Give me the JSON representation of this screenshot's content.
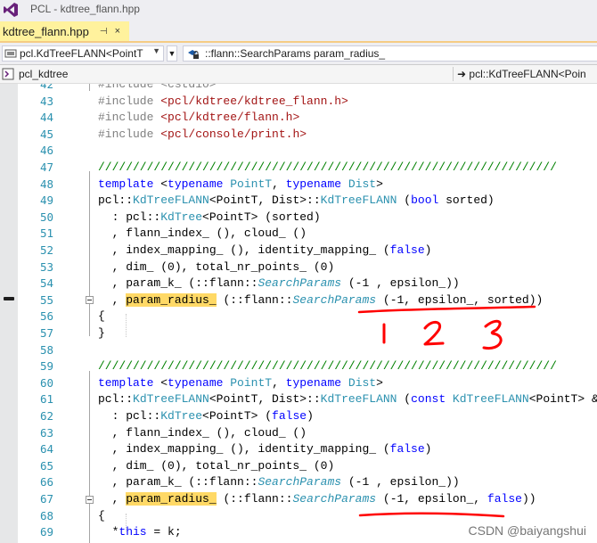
{
  "window": {
    "title": "PCL - kdtree_flann.hpp"
  },
  "tab": {
    "name": "kdtree_flann.hpp",
    "pin_glyph": "⊣",
    "close_glyph": "×"
  },
  "nav": {
    "scope": "pcl.KdTreeFLANN<PointT",
    "member": "::flann::SearchParams param_radius_",
    "project": "pcl_kdtree",
    "location": "➜ pcl::KdTreeFLANN<Poin"
  },
  "editor": {
    "lines": [
      {
        "n": "42",
        "tokens": [
          {
            "t": "#include <cstdio>",
            "c": "t-pp"
          }
        ]
      },
      {
        "n": "43",
        "tokens": [
          {
            "t": "#include ",
            "c": "t-pp"
          },
          {
            "t": "<pcl/kdtree/kdtree_flann.h>",
            "c": "t-str"
          }
        ]
      },
      {
        "n": "44",
        "tokens": [
          {
            "t": "#include ",
            "c": "t-pp"
          },
          {
            "t": "<pcl/kdtree/flann.h>",
            "c": "t-str"
          }
        ]
      },
      {
        "n": "45",
        "tokens": [
          {
            "t": "#include ",
            "c": "t-pp"
          },
          {
            "t": "<pcl/console/print.h>",
            "c": "t-str"
          }
        ]
      },
      {
        "n": "46",
        "tokens": []
      },
      {
        "n": "47",
        "tokens": [
          {
            "t": "//////////////////////////////////////////////////////////////////",
            "c": "t-cmt"
          }
        ]
      },
      {
        "n": "48",
        "tokens": [
          {
            "t": "template ",
            "c": "t-kw"
          },
          {
            "t": "<",
            "c": ""
          },
          {
            "t": "typename ",
            "c": "t-kw"
          },
          {
            "t": "PointT",
            "c": "t-type"
          },
          {
            "t": ", ",
            "c": ""
          },
          {
            "t": "typename ",
            "c": "t-kw"
          },
          {
            "t": "Dist",
            "c": "t-type"
          },
          {
            "t": ">",
            "c": ""
          }
        ]
      },
      {
        "n": "49",
        "tokens": [
          {
            "t": "pcl::",
            "c": ""
          },
          {
            "t": "KdTreeFLANN",
            "c": "t-type"
          },
          {
            "t": "<PointT, Dist>::",
            "c": ""
          },
          {
            "t": "KdTreeFLANN",
            "c": "t-type"
          },
          {
            "t": " (",
            "c": ""
          },
          {
            "t": "bool ",
            "c": "t-kw"
          },
          {
            "t": "sorted)",
            "c": ""
          }
        ]
      },
      {
        "n": "50",
        "tokens": [
          {
            "t": "  : pcl::",
            "c": ""
          },
          {
            "t": "KdTree",
            "c": "t-type"
          },
          {
            "t": "<PointT> (sorted)",
            "c": ""
          }
        ]
      },
      {
        "n": "51",
        "tokens": [
          {
            "t": "  , flann_index_ (), cloud_ ()",
            "c": ""
          }
        ]
      },
      {
        "n": "52",
        "tokens": [
          {
            "t": "  , index_mapping_ (), identity_mapping_ (",
            "c": ""
          },
          {
            "t": "false",
            "c": "t-kw"
          },
          {
            "t": ")",
            "c": ""
          }
        ]
      },
      {
        "n": "53",
        "tokens": [
          {
            "t": "  , dim_ (0), total_nr_points_ (0)",
            "c": ""
          }
        ]
      },
      {
        "n": "54",
        "tokens": [
          {
            "t": "  , param_k_ (::flann::",
            "c": ""
          },
          {
            "t": "SearchParams",
            "c": "t-it"
          },
          {
            "t": " (-1 , epsilon_))",
            "c": ""
          }
        ]
      },
      {
        "n": "55",
        "tokens": [
          {
            "t": "  , ",
            "c": ""
          },
          {
            "t": "param_radius_",
            "c": "hl"
          },
          {
            "t": " (::flann::",
            "c": ""
          },
          {
            "t": "SearchParams",
            "c": "t-it"
          },
          {
            "t": " (-1, epsilon_, sorted))",
            "c": ""
          }
        ]
      },
      {
        "n": "56",
        "tokens": [
          {
            "t": "{",
            "c": ""
          }
        ]
      },
      {
        "n": "57",
        "tokens": [
          {
            "t": "}",
            "c": ""
          }
        ]
      },
      {
        "n": "58",
        "tokens": []
      },
      {
        "n": "59",
        "tokens": [
          {
            "t": "//////////////////////////////////////////////////////////////////",
            "c": "t-cmt"
          }
        ]
      },
      {
        "n": "60",
        "tokens": [
          {
            "t": "template ",
            "c": "t-kw"
          },
          {
            "t": "<",
            "c": ""
          },
          {
            "t": "typename ",
            "c": "t-kw"
          },
          {
            "t": "PointT",
            "c": "t-type"
          },
          {
            "t": ", ",
            "c": ""
          },
          {
            "t": "typename ",
            "c": "t-kw"
          },
          {
            "t": "Dist",
            "c": "t-type"
          },
          {
            "t": ">",
            "c": ""
          }
        ]
      },
      {
        "n": "61",
        "tokens": [
          {
            "t": "pcl::",
            "c": ""
          },
          {
            "t": "KdTreeFLANN",
            "c": "t-type"
          },
          {
            "t": "<PointT, Dist>::",
            "c": ""
          },
          {
            "t": "KdTreeFLANN",
            "c": "t-type"
          },
          {
            "t": " (",
            "c": ""
          },
          {
            "t": "const ",
            "c": "t-kw"
          },
          {
            "t": "KdTreeFLANN",
            "c": "t-type"
          },
          {
            "t": "<PointT> &k)",
            "c": ""
          }
        ]
      },
      {
        "n": "62",
        "tokens": [
          {
            "t": "  : pcl::",
            "c": ""
          },
          {
            "t": "KdTree",
            "c": "t-type"
          },
          {
            "t": "<PointT> (",
            "c": ""
          },
          {
            "t": "false",
            "c": "t-kw"
          },
          {
            "t": ")",
            "c": ""
          }
        ]
      },
      {
        "n": "63",
        "tokens": [
          {
            "t": "  , flann_index_ (), cloud_ ()",
            "c": ""
          }
        ]
      },
      {
        "n": "64",
        "tokens": [
          {
            "t": "  , index_mapping_ (), identity_mapping_ (",
            "c": ""
          },
          {
            "t": "false",
            "c": "t-kw"
          },
          {
            "t": ")",
            "c": ""
          }
        ]
      },
      {
        "n": "65",
        "tokens": [
          {
            "t": "  , dim_ (0), total_nr_points_ (0)",
            "c": ""
          }
        ]
      },
      {
        "n": "66",
        "tokens": [
          {
            "t": "  , param_k_ (::flann::",
            "c": ""
          },
          {
            "t": "SearchParams",
            "c": "t-it"
          },
          {
            "t": " (-1 , epsilon_))",
            "c": ""
          }
        ]
      },
      {
        "n": "67",
        "tokens": [
          {
            "t": "  , ",
            "c": ""
          },
          {
            "t": "param_radius_",
            "c": "hl"
          },
          {
            "t": " (::flann::",
            "c": ""
          },
          {
            "t": "SearchParams",
            "c": "t-it"
          },
          {
            "t": " (-1, epsilon_, ",
            "c": ""
          },
          {
            "t": "false",
            "c": "t-kw"
          },
          {
            "t": "))",
            "c": ""
          }
        ]
      },
      {
        "n": "68",
        "tokens": [
          {
            "t": "{",
            "c": ""
          }
        ]
      },
      {
        "n": "69",
        "tokens": [
          {
            "t": "  *",
            "c": ""
          },
          {
            "t": "this",
            "c": "t-kw"
          },
          {
            "t": " = k;",
            "c": ""
          }
        ]
      }
    ]
  },
  "annotations": {
    "handwritten": "1 2 3",
    "color": "#ff0000"
  },
  "watermark": "CSDN @baiyangshui"
}
